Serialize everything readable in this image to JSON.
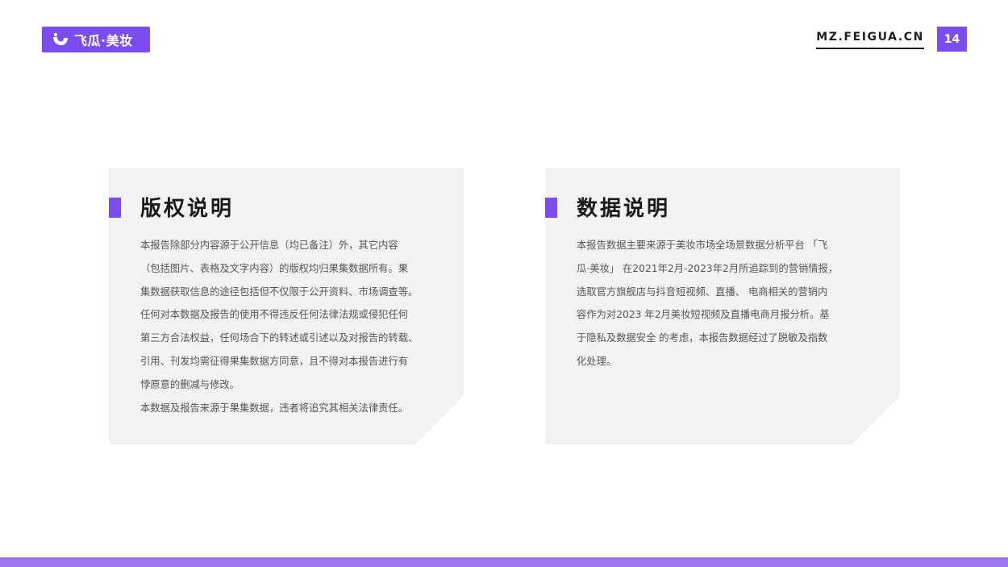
{
  "header": {
    "logo_text": "飞瓜·美妆",
    "site_url": "MZ.FEIGUA.CN",
    "page_number": "14"
  },
  "copyright": {
    "title": "版权说明",
    "lines": [
      "本报告除部分内容源于公开信息（均已备注）外，其它内容",
      "（包括图片、表格及文字内容）的版权均归果集数据所有。果",
      "集数据获取信息的途径包括但不仅限于公开资料、市场调查等。",
      "任何对本数据及报告的使用不得违反任何法律法规或侵犯任何",
      "第三方合法权益，任何场合下的转述或引述以及对报告的转载、",
      "引用、刊发均需征得果集数据方同意，且不得对本报告进行有",
      "悖原意的删减与修改。",
      "本数据及报告来源于果集数据，违者将追究其相关法律责任。"
    ]
  },
  "data_note": {
    "title": "数据说明",
    "lines": [
      "本报告数据主要来源于美妆市场全场景数据分析平台 「飞",
      "瓜·美妆」 在2021年2月-2023年2月所追踪到的营销情报，",
      "选取官方旗舰店与抖音短视频、直播、 电商相关的营销内",
      "容作为对2023 年2月美妆短视频及直播电商月报分析。基",
      "于隐私及数据安全 的考虑，本报告数据经过了脱敏及指数",
      "化处理。"
    ]
  },
  "colors": {
    "accent": "#7b4cf0",
    "bottom_bar": "#9b76ee",
    "card_bg": "#f2f2f2"
  }
}
